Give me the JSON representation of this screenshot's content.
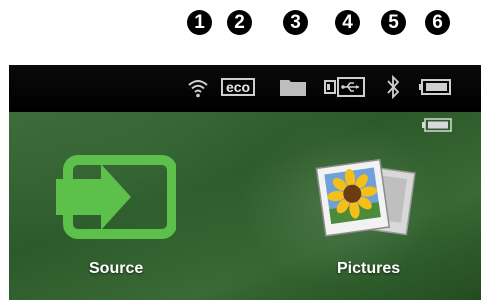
{
  "callouts": [
    "1",
    "2",
    "3",
    "4",
    "5",
    "6"
  ],
  "status_bar": {
    "icons": [
      "wifi-icon",
      "eco-mode-icon",
      "folder-icon",
      "usb-icon",
      "bluetooth-icon",
      "battery-icon"
    ],
    "eco_label": "eco"
  },
  "menu": {
    "tiles": [
      {
        "label": "Source",
        "icon": "source-input-icon"
      },
      {
        "label": "Pictures",
        "icon": "pictures-icon"
      }
    ]
  },
  "colors": {
    "source_icon": "#5cc04a",
    "battery": "#cfcfcf"
  }
}
